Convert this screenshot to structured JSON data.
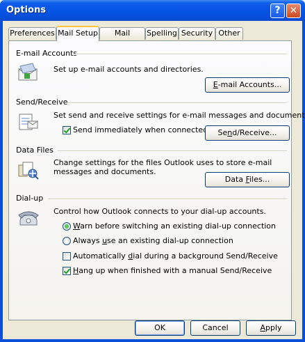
{
  "window": {
    "title": "Options"
  },
  "titlebar": {
    "help_glyph": "?",
    "close_glyph": "✕"
  },
  "tabs": [
    {
      "label": "Preferences",
      "active": false
    },
    {
      "label": "Mail Setup",
      "active": true
    },
    {
      "label": "Mail Format",
      "active": false
    },
    {
      "label": "Spelling",
      "active": false
    },
    {
      "label": "Security",
      "active": false
    },
    {
      "label": "Other",
      "active": false
    }
  ],
  "email_accounts": {
    "heading": "E-mail Accounts",
    "description": "Set up e-mail accounts and directories.",
    "button_mnemonic": "E",
    "button_rest": "-mail Accounts...",
    "icon": "email-accounts-icon"
  },
  "send_receive": {
    "heading": "Send/Receive",
    "description": "Set send and receive settings for e-mail messages and documents.",
    "checkbox_label": "Send immediately when connected",
    "checkbox_checked": true,
    "button_pre": "Se",
    "button_mnemonic": "n",
    "button_rest": "d/Receive...",
    "icon": "send-receive-icon"
  },
  "data_files": {
    "heading": "Data Files",
    "description": "Change settings for the files Outlook uses to store e-mail messages and documents.",
    "button_pre": "Data ",
    "button_mnemonic": "F",
    "button_rest": "iles...",
    "icon": "data-files-icon"
  },
  "dialup": {
    "heading": "Dial-up",
    "description": "Control how Outlook connects to your dial-up accounts.",
    "options": [
      {
        "type": "radio",
        "pre": "",
        "mnemonic": "W",
        "rest": "arn before switching an existing dial-up connection",
        "checked": true
      },
      {
        "type": "radio",
        "pre": "Always ",
        "mnemonic": "u",
        "rest": "se an existing dial-up connection",
        "checked": false
      },
      {
        "type": "checkbox",
        "pre": "Automatically ",
        "mnemonic": "d",
        "rest": "ial during a background Send/Receive",
        "checked": false
      },
      {
        "type": "checkbox",
        "pre": "",
        "mnemonic": "H",
        "rest": "ang up when finished with a manual Send/Receive",
        "checked": true
      }
    ],
    "icon": "dialup-phone-icon"
  },
  "footer": {
    "ok": "OK",
    "cancel": "Cancel",
    "apply_mnemonic": "A",
    "apply_rest": "pply"
  }
}
